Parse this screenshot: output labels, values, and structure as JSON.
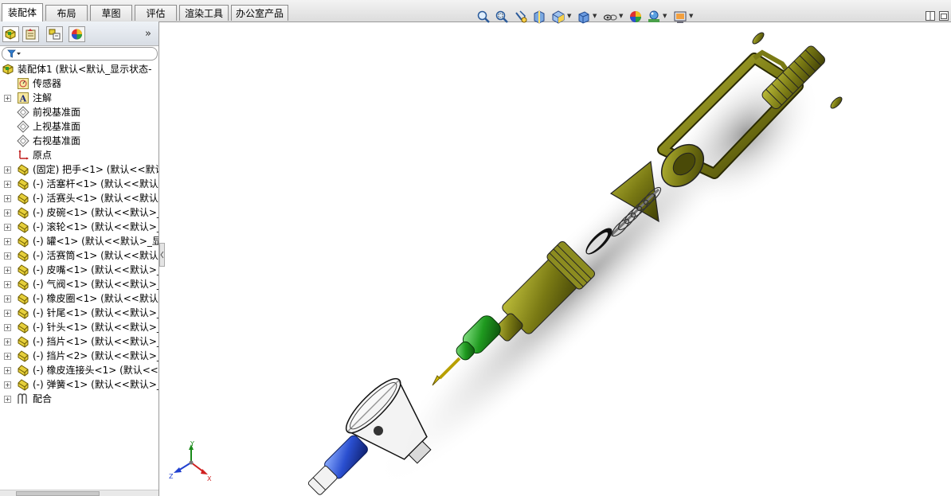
{
  "tabs": [
    {
      "label": "装配体",
      "active": true
    },
    {
      "label": "布局",
      "active": false
    },
    {
      "label": "草图",
      "active": false
    },
    {
      "label": "评估",
      "active": false
    },
    {
      "label": "渲染工具",
      "active": false
    },
    {
      "label": "办公室产品",
      "active": false
    }
  ],
  "panel_tabs_icons": [
    "feature-manager-icon",
    "property-manager-icon",
    "configuration-manager-icon",
    "display-manager-icon"
  ],
  "panel_more": "»",
  "filter_icon": "funnel-icon",
  "tree": {
    "root": "装配体1  (默认<默认_显示状态-",
    "items": [
      {
        "label": "传感器",
        "icon": "sensor-icon"
      },
      {
        "label": "注解",
        "icon": "annotation-icon"
      },
      {
        "label": "前视基准面",
        "icon": "plane-icon"
      },
      {
        "label": "上视基准面",
        "icon": "plane-icon"
      },
      {
        "label": "右视基准面",
        "icon": "plane-icon"
      },
      {
        "label": "原点",
        "icon": "origin-icon"
      }
    ],
    "parts": [
      "(固定) 把手<1> (默认<<默认",
      "(-) 活塞杆<1> (默认<<默认>",
      "(-) 活赛头<1> (默认<<默认>",
      "(-) 皮碗<1> (默认<<默认>_显",
      "(-) 滚轮<1> (默认<<默认>_显",
      "(-) 罐<1> (默认<<默认>_显示",
      "(-) 活赛筒<1> (默认<<默认>",
      "(-) 皮嘴<1> (默认<<默认>_显",
      "(-) 气阀<1> (默认<<默认>_显",
      "(-) 橡皮圈<1> (默认<<默认>",
      "(-) 针尾<1> (默认<<默认>_显",
      "(-) 针头<1> (默认<<默认>_显",
      "(-) 挡片<1> (默认<<默认>_显",
      "(-) 挡片<2> (默认<<默认>_显",
      "(-) 橡皮连接头<1> (默认<<默",
      "(-) 弹簧<1> (默认<<默认>_显"
    ],
    "mates": "配合"
  },
  "view_toolbar_icons": [
    "zoom-to-fit-icon",
    "zoom-area-icon",
    "previous-view-icon",
    "section-view-icon",
    "view-orientation-icon",
    "display-style-icon",
    "hide-show-icon",
    "appearance-icon",
    "scene-icon",
    "view-settings-icon"
  ],
  "window_icons": [
    "tile-icon",
    "maximize-icon"
  ],
  "triad": {
    "x": "X",
    "y": "Y",
    "z": "Z"
  },
  "colors": {
    "olive": "#7a7a14",
    "green": "#1f9a1f",
    "blue": "#2a4fd0",
    "accent": "#1e5fb3"
  }
}
